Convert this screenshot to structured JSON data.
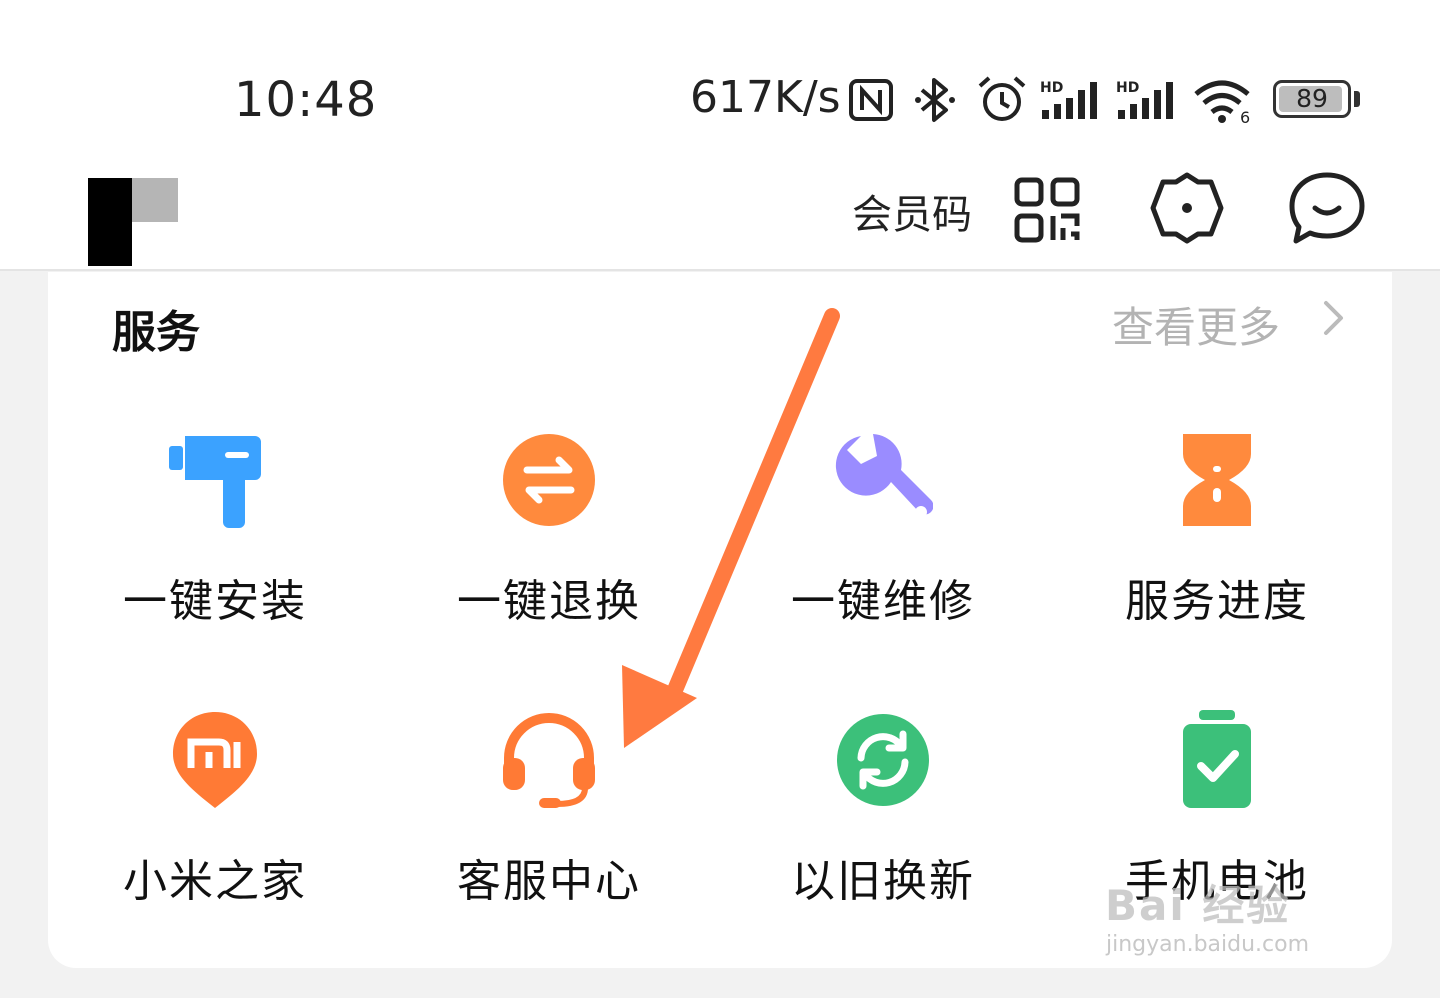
{
  "status_bar": {
    "time": "10:48",
    "speed": "617K/s",
    "hd1": "HD",
    "hd2": "HD",
    "battery": "89",
    "icons": [
      "nfc-icon",
      "bluetooth-icon",
      "alarm-icon",
      "signal-icon",
      "signal-icon",
      "wifi-icon",
      "battery-icon"
    ]
  },
  "header": {
    "member_code": "会员码",
    "icons": [
      "qr-code-icon",
      "settings-icon",
      "message-icon"
    ]
  },
  "services": {
    "title": "服务",
    "more": "查看更多",
    "items": [
      {
        "label": "一键安装",
        "icon": "drill-icon",
        "color": "#3ba2ff"
      },
      {
        "label": "一键退换",
        "icon": "exchange-icon",
        "color": "#ff8a3d"
      },
      {
        "label": "一键维修",
        "icon": "wrench-icon",
        "color": "#9a8cff"
      },
      {
        "label": "服务进度",
        "icon": "hourglass-icon",
        "color": "#ff8a3d"
      },
      {
        "label": "小米之家",
        "icon": "mi-location-icon",
        "color": "#ff7a35"
      },
      {
        "label": "客服中心",
        "icon": "headset-icon",
        "color": "#ff7a35"
      },
      {
        "label": "以旧换新",
        "icon": "refresh-icon",
        "color": "#3cc07a"
      },
      {
        "label": "手机电池",
        "icon": "battery-check-icon",
        "color": "#3cc07a"
      }
    ]
  },
  "annotation": {
    "arrow_color": "#ff7a40"
  },
  "watermark": {
    "line1": "Bai 经验",
    "line2": "jingyan.baidu.com"
  }
}
